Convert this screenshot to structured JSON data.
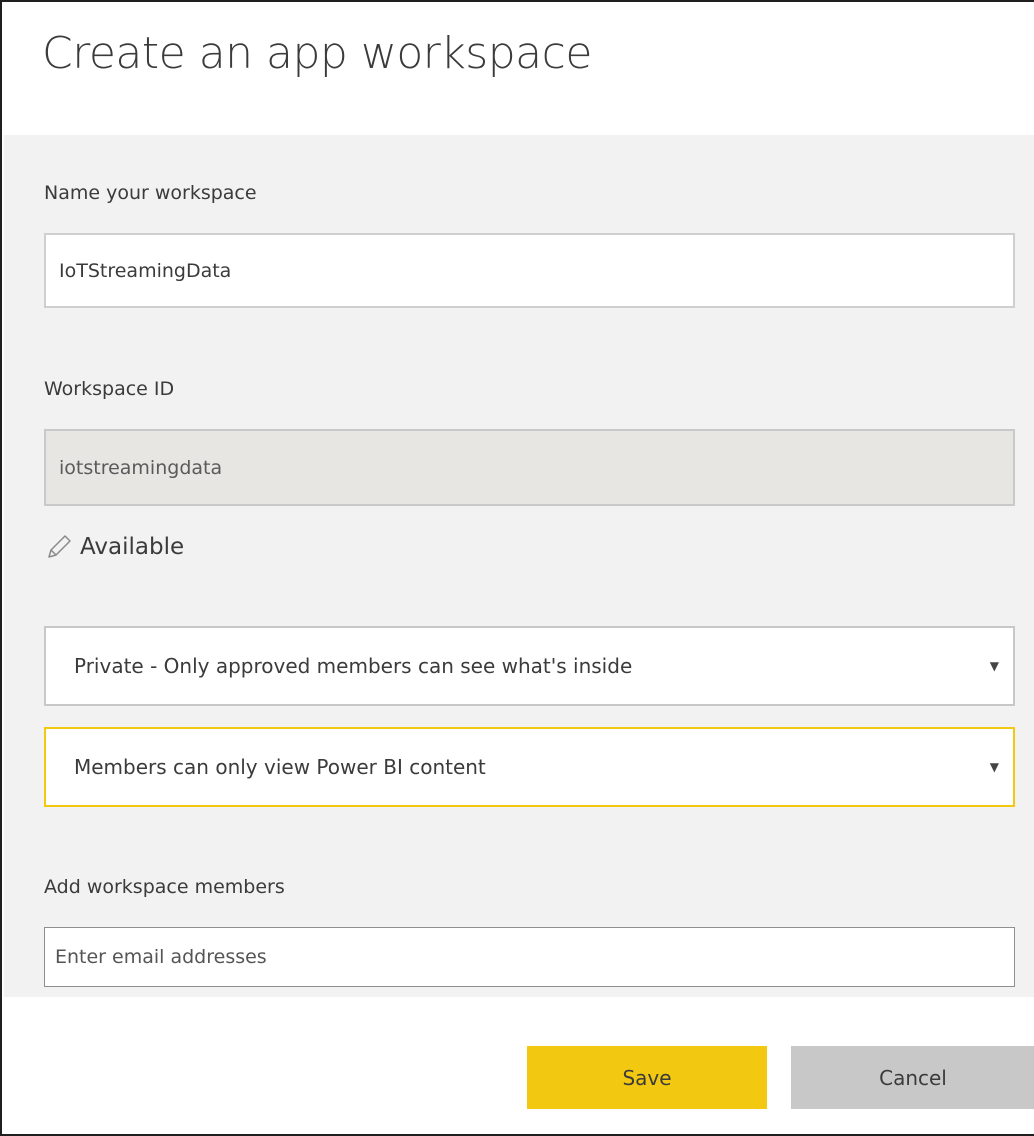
{
  "dialog": {
    "title": "Create an app workspace"
  },
  "name_field": {
    "label": "Name your workspace",
    "value": "IoTStreamingData"
  },
  "id_field": {
    "label": "Workspace ID",
    "value": "iotstreamingdata"
  },
  "availability": {
    "icon": "pencil-icon",
    "text": "Available"
  },
  "privacy_select": {
    "selected": "Private - Only approved members can see what's inside"
  },
  "permission_select": {
    "selected": "Members can only view Power BI content"
  },
  "members": {
    "label": "Add workspace members",
    "placeholder": "Enter email addresses"
  },
  "actions": {
    "save_label": "Save",
    "cancel_label": "Cancel"
  },
  "colors": {
    "accent": "#f2c811",
    "panel": "#f2f2f2",
    "cancel": "#c8c8c8"
  }
}
